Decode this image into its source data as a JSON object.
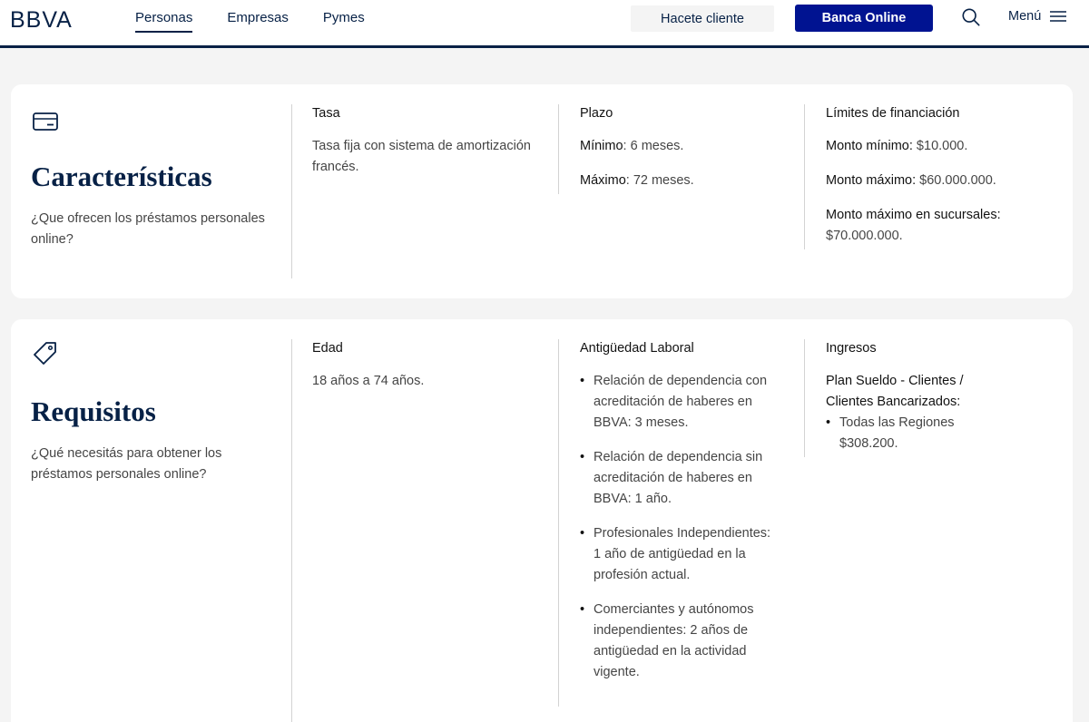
{
  "header": {
    "logo": "BBVA",
    "nav": [
      "Personas",
      "Empresas",
      "Pymes"
    ],
    "hacete_cliente": "Hacete cliente",
    "banca_online": "Banca Online",
    "menu": "Menú"
  },
  "caracteristicas": {
    "title": "Características",
    "subtitle": "¿Que ofrecen los préstamos personales online?",
    "tasa": {
      "head": "Tasa",
      "text": "Tasa fija con sistema de  amortización francés."
    },
    "plazo": {
      "head": "Plazo",
      "min_label": "Mínimo",
      "min_value": ": 6 meses.",
      "max_label": "Máximo",
      "max_value": ": 72 meses."
    },
    "limites": {
      "head": "Límites de financiación",
      "min_label": "Monto mínimo:",
      "min_value": " $10.000.",
      "max_label": "Monto máximo:",
      "max_value": " $60.000.000.",
      "suc_label": "Monto máximo en sucursales:",
      "suc_value": "$70.000.000."
    }
  },
  "requisitos": {
    "title": "Requisitos",
    "subtitle": "¿Qué necesitás para obtener los préstamos personales online?",
    "edad": {
      "head": "Edad",
      "text": "18 años a 74 años."
    },
    "antiguedad": {
      "head": "Antigüedad Laboral",
      "items": [
        "Relación de dependencia con acreditación de haberes en BBVA: 3 meses.",
        "Relación de dependencia sin acreditación de haberes en BBVA: 1 año.",
        "Profesionales Independientes: 1 año de antigüedad en la profesión actual.",
        "Comerciantes y autónomos independientes: 2 años de antigüedad en la actividad vigente."
      ]
    },
    "ingresos": {
      "head": "Ingresos",
      "plan_label": "Plan Sueldo -  Clientes / Clientes Bancarizados:",
      "items": [
        "Todas las Regiones $308.200."
      ]
    }
  }
}
